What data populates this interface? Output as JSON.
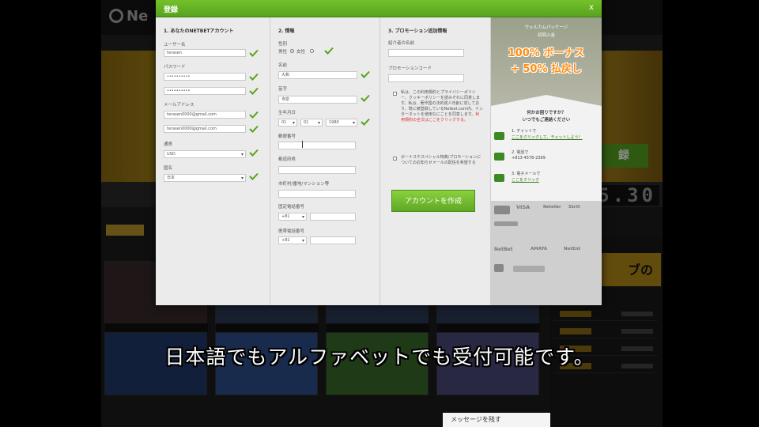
{
  "modal": {
    "title": "登録",
    "close_glyph": "x",
    "col1": {
      "title": "1. あなたのNETBETアカウント",
      "username_label": "ユーザー名",
      "username_value": "terasen",
      "password_label": "パスワード",
      "password_value": "••••••••••",
      "password_confirm_value": "••••••••••",
      "email_label": "メールアドレス",
      "email_value": "terasen0000@gmail.com",
      "email_confirm_value": "terasen0000@gmail.com",
      "currency_label": "通貨",
      "currency_value": "USD",
      "country_label": "国名",
      "country_value": "日本"
    },
    "col2": {
      "title": "2. 情報",
      "gender_label": "性別",
      "gender_male": "男性",
      "gender_female": "女性",
      "firstname_label": "名前",
      "firstname_value": "大和",
      "lastname_label": "苗字",
      "lastname_value": "寺泉",
      "dob_label": "生年月日",
      "dob_day": "01",
      "dob_month": "01",
      "dob_year": "1980",
      "postcode_label": "郵便番号",
      "prefecture_label": "都道府県",
      "address_label": "市町村/番地/マンション等",
      "phone_label": "固定電話番号",
      "phone_code": "+81",
      "mobile_label": "携帯電話番号",
      "mobile_code": "+81"
    },
    "col3": {
      "title": "3. プロモーション追加情報",
      "referrer_label": "紹介者の名前",
      "promo_label": "プロモーションコード",
      "terms_text": "私は、この利用規約とプライバシーポリシー、クッキーポリシーを読みそれに同意します。私は、著作国の法的成人年齢に達しており、既に被登録しているNetbet.com内、インターネットを使用なにことを同意します。",
      "terms_link": "利用規約の全文はここをクリックする。",
      "newsletter_text": "ボーナスやスペシャル特典/プロモーションについてのお知らせメールの配信を希望する",
      "create_button": "アカウントを作成"
    },
    "promo": {
      "line1": "ウェルカムパッケージ",
      "line2": "初回入金",
      "bonus1": "100% ボーナス",
      "bonus2": "+ 50% 払戻し",
      "help_title1": "何かお困りですか？",
      "help_title2": "いつでもご連絡ください",
      "chat_label": "1. チャットで",
      "chat_link": "ここをクリックして、チャットしよう！",
      "phone_label": "2. 電話で",
      "phone_number": "+813-4578-2399",
      "mail_label": "3. 電子メールで",
      "mail_link": "ここをクリック",
      "payments": [
        "mastercard",
        "VISA",
        "Neteller",
        "Skrill"
      ],
      "brands": [
        "NetBet",
        "AMAYA",
        "NetEnt"
      ]
    }
  },
  "background": {
    "logo": "Ne",
    "hero_button": "録",
    "jackpot": "5.30",
    "side_banner": "ブの",
    "message_bar": "メッセージを残す"
  },
  "caption": "日本語でもアルファベットでも受付可能です。",
  "colors": {
    "accent": "#57a31f",
    "promo_orange": "#ff8c10",
    "link_red": "#d33333"
  }
}
